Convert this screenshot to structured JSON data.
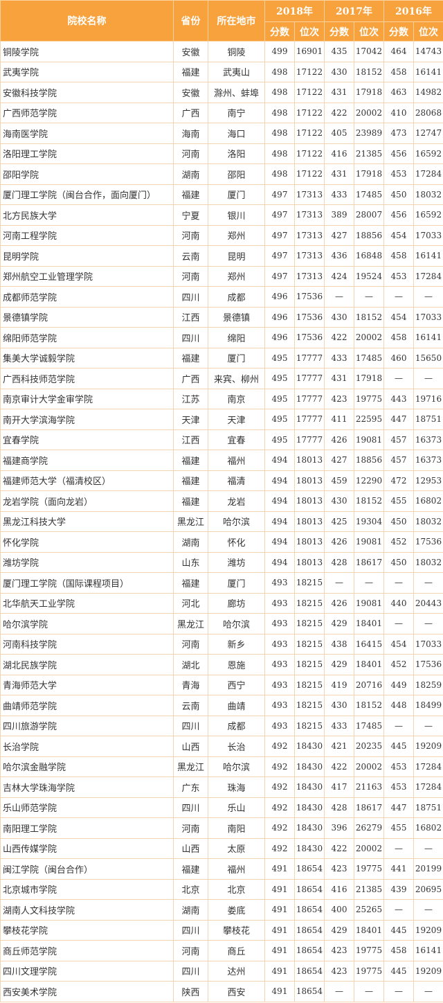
{
  "header": {
    "school": "院校名称",
    "province": "省份",
    "city": "所在地市",
    "years": [
      "2018年",
      "2017年",
      "2016年"
    ],
    "score": "分数",
    "rank": "位次"
  },
  "rows": [
    [
      "铜陵学院",
      "安徽",
      "铜陵",
      "499",
      "16901",
      "435",
      "17042",
      "464",
      "14743"
    ],
    [
      "武夷学院",
      "福建",
      "武夷山",
      "498",
      "17122",
      "430",
      "18152",
      "458",
      "16141"
    ],
    [
      "安徽科技学院",
      "安徽",
      "滁州、蚌埠",
      "498",
      "17122",
      "431",
      "17918",
      "463",
      "14982"
    ],
    [
      "广西师范学院",
      "广西",
      "南宁",
      "498",
      "17122",
      "422",
      "20002",
      "410",
      "28068"
    ],
    [
      "海南医学院",
      "海南",
      "海口",
      "498",
      "17122",
      "405",
      "23989",
      "473",
      "12747"
    ],
    [
      "洛阳理工学院",
      "河南",
      "洛阳",
      "498",
      "17122",
      "416",
      "21385",
      "456",
      "16592"
    ],
    [
      "邵阳学院",
      "湖南",
      "邵阳",
      "498",
      "17122",
      "431",
      "17918",
      "453",
      "17284"
    ],
    [
      "厦门理工学院（闽台合作，面向厦门）",
      "福建",
      "厦门",
      "497",
      "17313",
      "433",
      "17485",
      "450",
      "18032"
    ],
    [
      "北方民族大学",
      "宁夏",
      "银川",
      "497",
      "17313",
      "389",
      "28007",
      "456",
      "16592"
    ],
    [
      "河南工程学院",
      "河南",
      "郑州",
      "497",
      "17313",
      "427",
      "18856",
      "454",
      "17033"
    ],
    [
      "昆明学院",
      "云南",
      "昆明",
      "497",
      "17313",
      "436",
      "16848",
      "458",
      "16141"
    ],
    [
      "郑州航空工业管理学院",
      "河南",
      "郑州",
      "497",
      "17313",
      "424",
      "19524",
      "453",
      "17284"
    ],
    [
      "成都师范学院",
      "四川",
      "成都",
      "496",
      "17536",
      "—",
      "—",
      "—",
      "—"
    ],
    [
      "景德镇学院",
      "江西",
      "景德镇",
      "496",
      "17536",
      "430",
      "18152",
      "454",
      "17033"
    ],
    [
      "绵阳师范学院",
      "四川",
      "绵阳",
      "496",
      "17536",
      "422",
      "20002",
      "458",
      "16141"
    ],
    [
      "集美大学诚毅学院",
      "福建",
      "厦门",
      "495",
      "17777",
      "433",
      "17485",
      "460",
      "15650"
    ],
    [
      "广西科技师范学院",
      "广西",
      "来宾、柳州",
      "495",
      "17777",
      "431",
      "17918",
      "—",
      "—"
    ],
    [
      "南京审计大学金审学院",
      "江苏",
      "南京",
      "495",
      "17777",
      "423",
      "19775",
      "443",
      "19716"
    ],
    [
      "南开大学滨海学院",
      "天津",
      "天津",
      "495",
      "17777",
      "411",
      "22595",
      "447",
      "18751"
    ],
    [
      "宜春学院",
      "江西",
      "宜春",
      "495",
      "17777",
      "426",
      "19081",
      "457",
      "16373"
    ],
    [
      "福建商学院",
      "福建",
      "福州",
      "494",
      "18013",
      "427",
      "18856",
      "457",
      "16373"
    ],
    [
      "福建师范大学（福清校区）",
      "福建",
      "福清",
      "494",
      "18013",
      "459",
      "12290",
      "472",
      "12953"
    ],
    [
      "龙岩学院（面向龙岩）",
      "福建",
      "龙岩",
      "494",
      "18013",
      "430",
      "18152",
      "455",
      "16802"
    ],
    [
      "黑龙江科技大学",
      "黑龙江",
      "哈尔滨",
      "494",
      "18013",
      "425",
      "19304",
      "450",
      "18032"
    ],
    [
      "怀化学院",
      "湖南",
      "怀化",
      "494",
      "18013",
      "426",
      "19081",
      "452",
      "17536"
    ],
    [
      "潍坊学院",
      "山东",
      "潍坊",
      "494",
      "18013",
      "428",
      "18617",
      "450",
      "18032"
    ],
    [
      "厦门理工学院（国际课程项目）",
      "福建",
      "厦门",
      "493",
      "18215",
      "—",
      "—",
      "—",
      "—"
    ],
    [
      "北华航天工业学院",
      "河北",
      "廊坊",
      "493",
      "18215",
      "426",
      "19081",
      "440",
      "20443"
    ],
    [
      "哈尔滨学院",
      "黑龙江",
      "哈尔滨",
      "493",
      "18215",
      "429",
      "18401",
      "—",
      "—"
    ],
    [
      "河南科技学院",
      "河南",
      "新乡",
      "493",
      "18215",
      "438",
      "16415",
      "454",
      "17033"
    ],
    [
      "湖北民族学院",
      "湖北",
      "恩施",
      "493",
      "18215",
      "429",
      "18401",
      "452",
      "17536"
    ],
    [
      "青海师范大学",
      "青海",
      "西宁",
      "493",
      "18215",
      "419",
      "20716",
      "449",
      "18259"
    ],
    [
      "曲靖师范学院",
      "云南",
      "曲靖",
      "493",
      "18215",
      "430",
      "18152",
      "448",
      "18499"
    ],
    [
      "四川旅游学院",
      "四川",
      "成都",
      "493",
      "18215",
      "433",
      "17485",
      "—",
      "—"
    ],
    [
      "长治学院",
      "山西",
      "长治",
      "492",
      "18430",
      "421",
      "20235",
      "445",
      "19209"
    ],
    [
      "哈尔滨金融学院",
      "黑龙江",
      "哈尔滨",
      "492",
      "18430",
      "422",
      "20002",
      "453",
      "17284"
    ],
    [
      "吉林大学珠海学院",
      "广东",
      "珠海",
      "492",
      "18430",
      "417",
      "21163",
      "453",
      "17284"
    ],
    [
      "乐山师范学院",
      "四川",
      "乐山",
      "492",
      "18430",
      "428",
      "18617",
      "447",
      "18751"
    ],
    [
      "南阳理工学院",
      "河南",
      "南阳",
      "492",
      "18430",
      "396",
      "26279",
      "455",
      "16802"
    ],
    [
      "山西传媒学院",
      "山西",
      "太原",
      "492",
      "18430",
      "422",
      "20002",
      "—",
      "—"
    ],
    [
      "闽江学院（闽台合作）",
      "福建",
      "福州",
      "491",
      "18654",
      "423",
      "19775",
      "441",
      "20199"
    ],
    [
      "北京城市学院",
      "北京",
      "北京",
      "491",
      "18654",
      "416",
      "21385",
      "439",
      "20695"
    ],
    [
      "湖南人文科技学院",
      "湖南",
      "娄底",
      "491",
      "18654",
      "400",
      "25265",
      "—",
      "—"
    ],
    [
      "攀枝花学院",
      "四川",
      "攀枝花",
      "491",
      "18654",
      "429",
      "18401",
      "445",
      "19209"
    ],
    [
      "商丘师范学院",
      "河南",
      "商丘",
      "491",
      "18654",
      "423",
      "19775",
      "458",
      "16141"
    ],
    [
      "四川文理学院",
      "四川",
      "达州",
      "491",
      "18654",
      "423",
      "19775",
      "445",
      "19209"
    ],
    [
      "西安美术学院",
      "陕西",
      "西安",
      "491",
      "18654",
      "—",
      "—",
      "—",
      "—"
    ]
  ]
}
